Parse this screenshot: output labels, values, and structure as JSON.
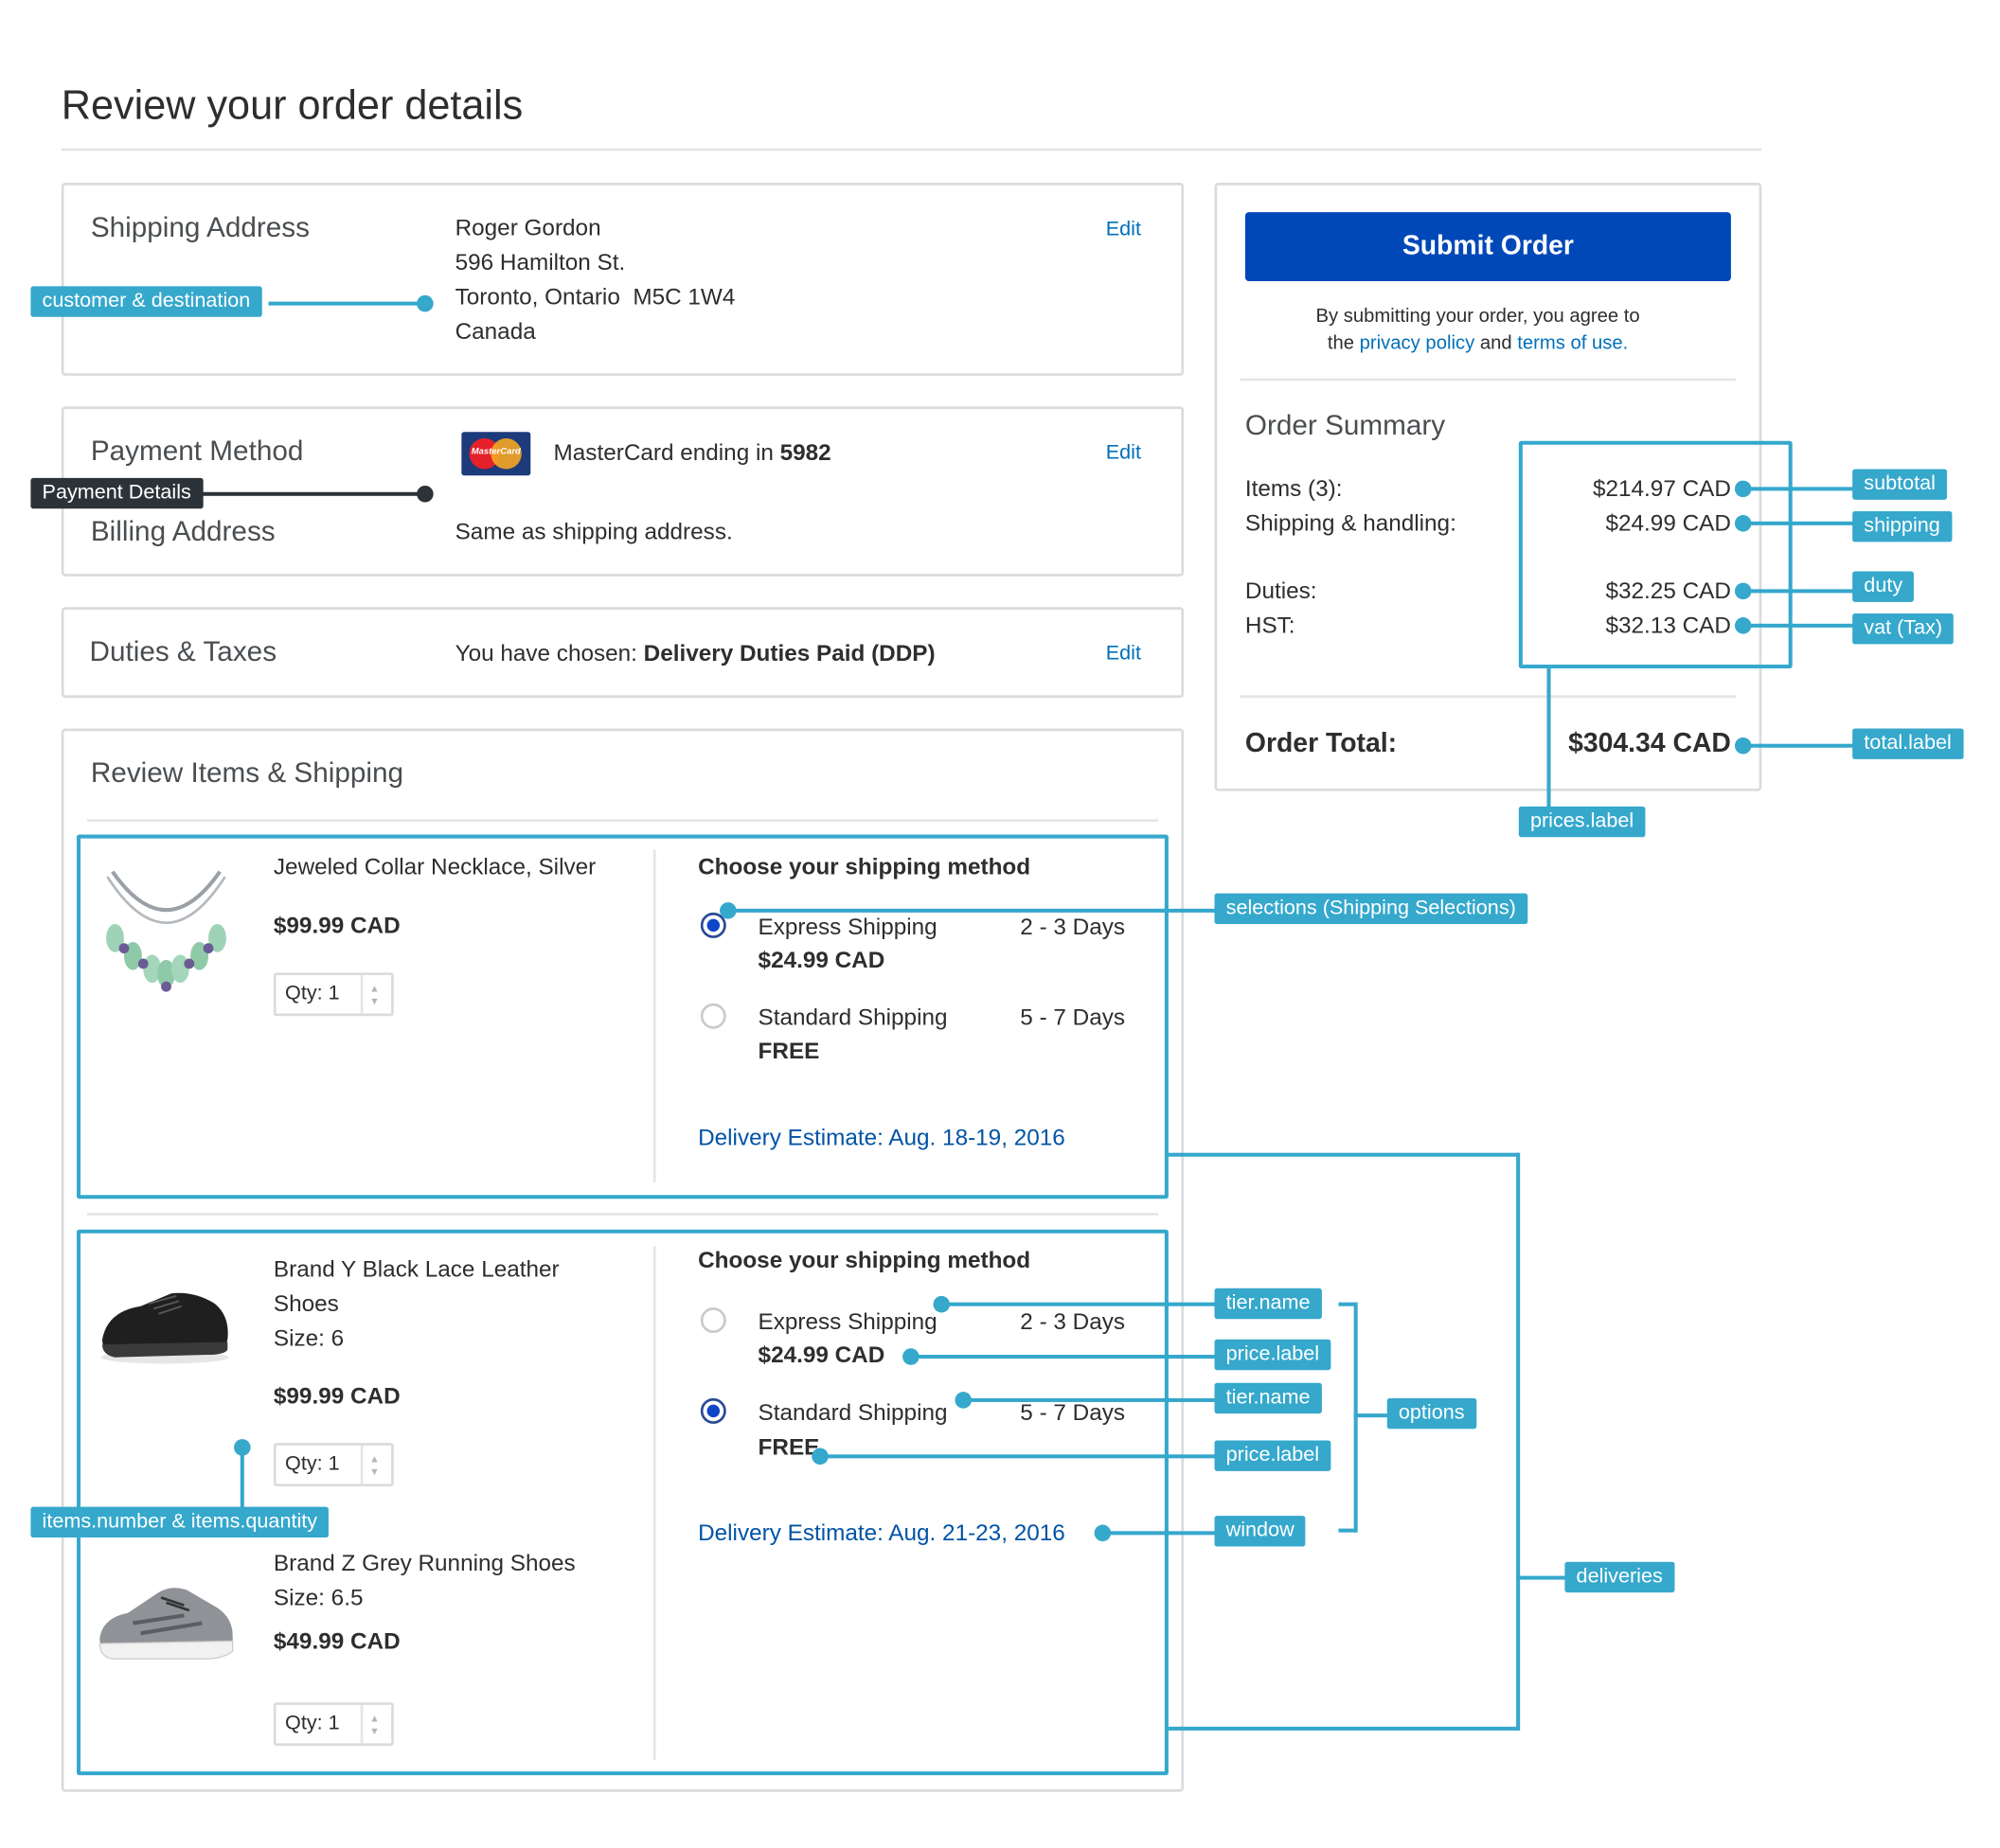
{
  "page": {
    "title": "Review your order details"
  },
  "shipping_address": {
    "heading": "Shipping Address",
    "name": "Roger Gordon",
    "street": "596 Hamilton St.",
    "city_line": "Toronto, Ontario  M5C 1W4",
    "country": "Canada",
    "edit_label": "Edit"
  },
  "payment": {
    "heading": "Payment Method",
    "card_text": "MasterCard ending in ",
    "card_last4": "5982",
    "card_logo_text": "MasterCard",
    "billing_heading": "Billing Address",
    "billing_value": "Same as shipping address.",
    "edit_label": "Edit"
  },
  "duties": {
    "heading": "Duties & Taxes",
    "chosen_prefix": "You have chosen: ",
    "chosen_value": "Delivery Duties Paid (DDP)",
    "edit_label": "Edit"
  },
  "review": {
    "heading": "Review Items & Shipping",
    "shipping_heading": "Choose your shipping method",
    "qty_label": "Qty: 1",
    "deliveries": [
      {
        "items": [
          {
            "name": "Jeweled Collar Necklace, Silver",
            "price": "$99.99 CAD"
          }
        ],
        "options": [
          {
            "tier": "Express Shipping",
            "days": "2 - 3 Days",
            "price": "$24.99 CAD",
            "selected": true
          },
          {
            "tier": "Standard Shipping",
            "days": "5 - 7 Days",
            "price": "FREE",
            "selected": false
          }
        ],
        "estimate": "Delivery Estimate: Aug. 18-19, 2016"
      },
      {
        "items": [
          {
            "name_line1": "Brand Y Black Lace Leather",
            "name_line2": "Shoes",
            "size": "Size: 6",
            "price": "$99.99 CAD"
          },
          {
            "name": "Brand Z Grey Running Shoes",
            "size": "Size: 6.5",
            "price": "$49.99 CAD"
          }
        ],
        "options": [
          {
            "tier": "Express Shipping",
            "days": "2 - 3 Days",
            "price": "$24.99 CAD",
            "selected": false
          },
          {
            "tier": "Standard Shipping",
            "days": "5 - 7 Days",
            "price": "FREE",
            "selected": true
          }
        ],
        "estimate": "Delivery Estimate: Aug. 21-23, 2016"
      }
    ]
  },
  "summary": {
    "submit_label": "Submit Order",
    "agree_line1": "By submitting your order, you agree to",
    "agree_the": "the ",
    "privacy_link": "privacy policy",
    "agree_and": " and ",
    "terms_link": "terms of use",
    "agree_end": ".",
    "heading": "Order Summary",
    "items_label": "Items (3):",
    "items_value": "$214.97 CAD",
    "shipping_label": "Shipping & handling:",
    "shipping_value": "$24.99 CAD",
    "duties_label": "Duties:",
    "duties_value": "$32.25 CAD",
    "hst_label": "HST:",
    "hst_value": "$32.13 CAD",
    "total_label": "Order Total:",
    "total_value": "$304.34 CAD"
  },
  "annotations": {
    "customer_destination": "customer & destination",
    "payment_details": "Payment Details",
    "subtotal": "subtotal",
    "shipping": "shipping",
    "duty": "duty",
    "vat": "vat (Tax)",
    "total_label": "total.label",
    "prices_label": "prices.label",
    "selections": "selections (Shipping Selections)",
    "tier_name_1": "tier.name",
    "price_label_1": "price.label",
    "tier_name_2": "tier.name",
    "price_label_2": "price.label",
    "options": "options",
    "window": "window",
    "deliveries": "deliveries",
    "items_number_quantity": "items.number & items.quantity"
  },
  "colors": {
    "accent": "#35a8cc",
    "submit_button": "#0048b8",
    "link": "#0070ba",
    "estimate": "#0053a5"
  }
}
